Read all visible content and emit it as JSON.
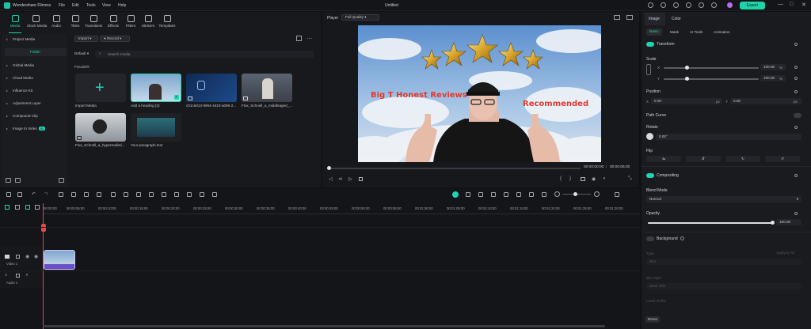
{
  "app": {
    "name": "Wondershare Filmora",
    "title": "Untitled",
    "export_label": "Export",
    "min": "—",
    "max": "□",
    "close": "✕"
  },
  "menu": [
    "File",
    "Edit",
    "Tools",
    "View",
    "Help"
  ],
  "media_tabs": [
    "Media",
    "Stock Media",
    "Audio",
    "Titles",
    "Transitions",
    "Effects",
    "Filters",
    "Stickers",
    "Templates"
  ],
  "sidebar": {
    "project_media": "Project Media",
    "folder": "Folder",
    "items": [
      "Global Media",
      "Cloud Media",
      "Influence Kit",
      "Adjustment Layer",
      "Compound Clip",
      "Image to Video"
    ],
    "ai_badge": "AI"
  },
  "toolbar": {
    "import": "Import",
    "record": "Record",
    "sort": "Default",
    "search_placeholder": "Search media",
    "folder_header": "FOLDER"
  },
  "media_items": [
    {
      "label": "Import Media"
    },
    {
      "label": "Add a heading (3)"
    },
    {
      "label": "c01c6d13-9994-4410-a096-2..."
    },
    {
      "label": "Flux_Schnell_a_middleaged_..."
    },
    {
      "label": "Flux_Schnell_a_hyperrealisti..."
    },
    {
      "label": "Your paragraph text"
    }
  ],
  "player": {
    "label": "Player",
    "quality": "Full Quality",
    "current_time": "00:00:00:00",
    "separator": "/",
    "total_time": "00:00:05:00",
    "video_text_left": "Big T Honest Reviews",
    "video_text_right": "Recommended"
  },
  "right_panel": {
    "tabs": [
      "Image",
      "Color"
    ],
    "subtabs": [
      "Basic",
      "Mask",
      "AI Tools",
      "Animation"
    ],
    "transform": "Transform",
    "scale": "Scale",
    "scale_x": "X",
    "scale_y": "Y",
    "scale_x_val": "100.00",
    "scale_y_val": "100.00",
    "percent": "%",
    "position": "Position",
    "pos_x_label": "X",
    "pos_x": "0.00",
    "pos_y_label": "Y",
    "pos_y": "0.00",
    "px": "px",
    "path_curve": "Path Curve",
    "rotate": "Rotate",
    "rotate_val": "0.00°",
    "flip": "Flip",
    "compositing": "Compositing",
    "blend_mode": "Blend Mode",
    "blend_val": "Normal",
    "opacity": "Opacity",
    "opacity_val": "100.00",
    "background": "Background",
    "type": "Type",
    "type_val": "Blur",
    "apply_all": "Apply to All",
    "blur_style": "Blur style",
    "blur_style_val": "Basic Blur",
    "level_of_blur": "Level of blur",
    "reset": "Reset",
    "opacity_level": 1.0
  },
  "timeline": {
    "ticks": [
      "00:00:00",
      "00:00:05:00",
      "00:00:10:00",
      "00:00:15:00",
      "00:00:20:00",
      "00:00:25:00",
      "00:00:30:00",
      "00:00:35:00",
      "00:00:40:00",
      "00:00:45:00",
      "00:00:50:00",
      "00:00:55:00",
      "00:01:00:00",
      "00:01:05:00",
      "00:01:10:00",
      "00:01:15:00",
      "00:01:20:00",
      "00:01:25:00",
      "00:01:30:00"
    ],
    "video_track": "Video 1",
    "audio_track": "Audio 1"
  },
  "colors": {
    "accent": "#1fd4b0",
    "bg": "#111214",
    "clip": "#6a4fc9"
  }
}
